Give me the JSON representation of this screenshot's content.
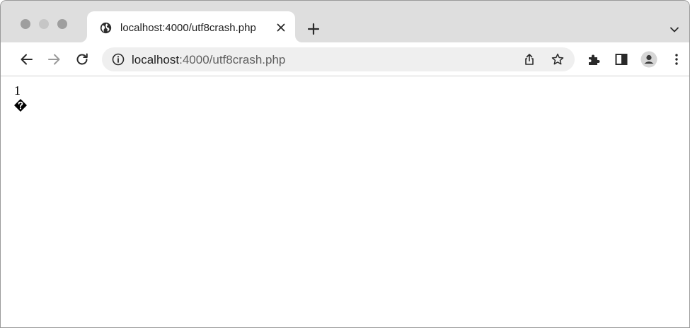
{
  "window": {
    "traffic_lights": [
      "close",
      "minimize",
      "maximize"
    ]
  },
  "tab": {
    "title": "localhost:4000/utf8crash.php",
    "favicon": "globe-icon",
    "close_icon": "close-icon"
  },
  "toolbar": {
    "back_icon": "back-arrow-icon",
    "forward_icon": "forward-arrow-icon",
    "reload_icon": "reload-icon",
    "url_host": "localhost",
    "url_rest": ":4000/utf8crash.php",
    "info_icon": "info-icon",
    "share_icon": "share-icon",
    "bookmark_icon": "star-icon",
    "extensions_icon": "puzzle-icon",
    "side_panel_icon": "side-panel-icon",
    "profile_icon": "profile-avatar-icon",
    "menu_icon": "kebab-menu-icon"
  },
  "page": {
    "line1": "1",
    "line2_glyph": "replacement-character-icon"
  },
  "colors": {
    "tabstrip_bg": "#dedede",
    "omnibox_bg": "#efefef",
    "text": "#1f1f1f"
  }
}
